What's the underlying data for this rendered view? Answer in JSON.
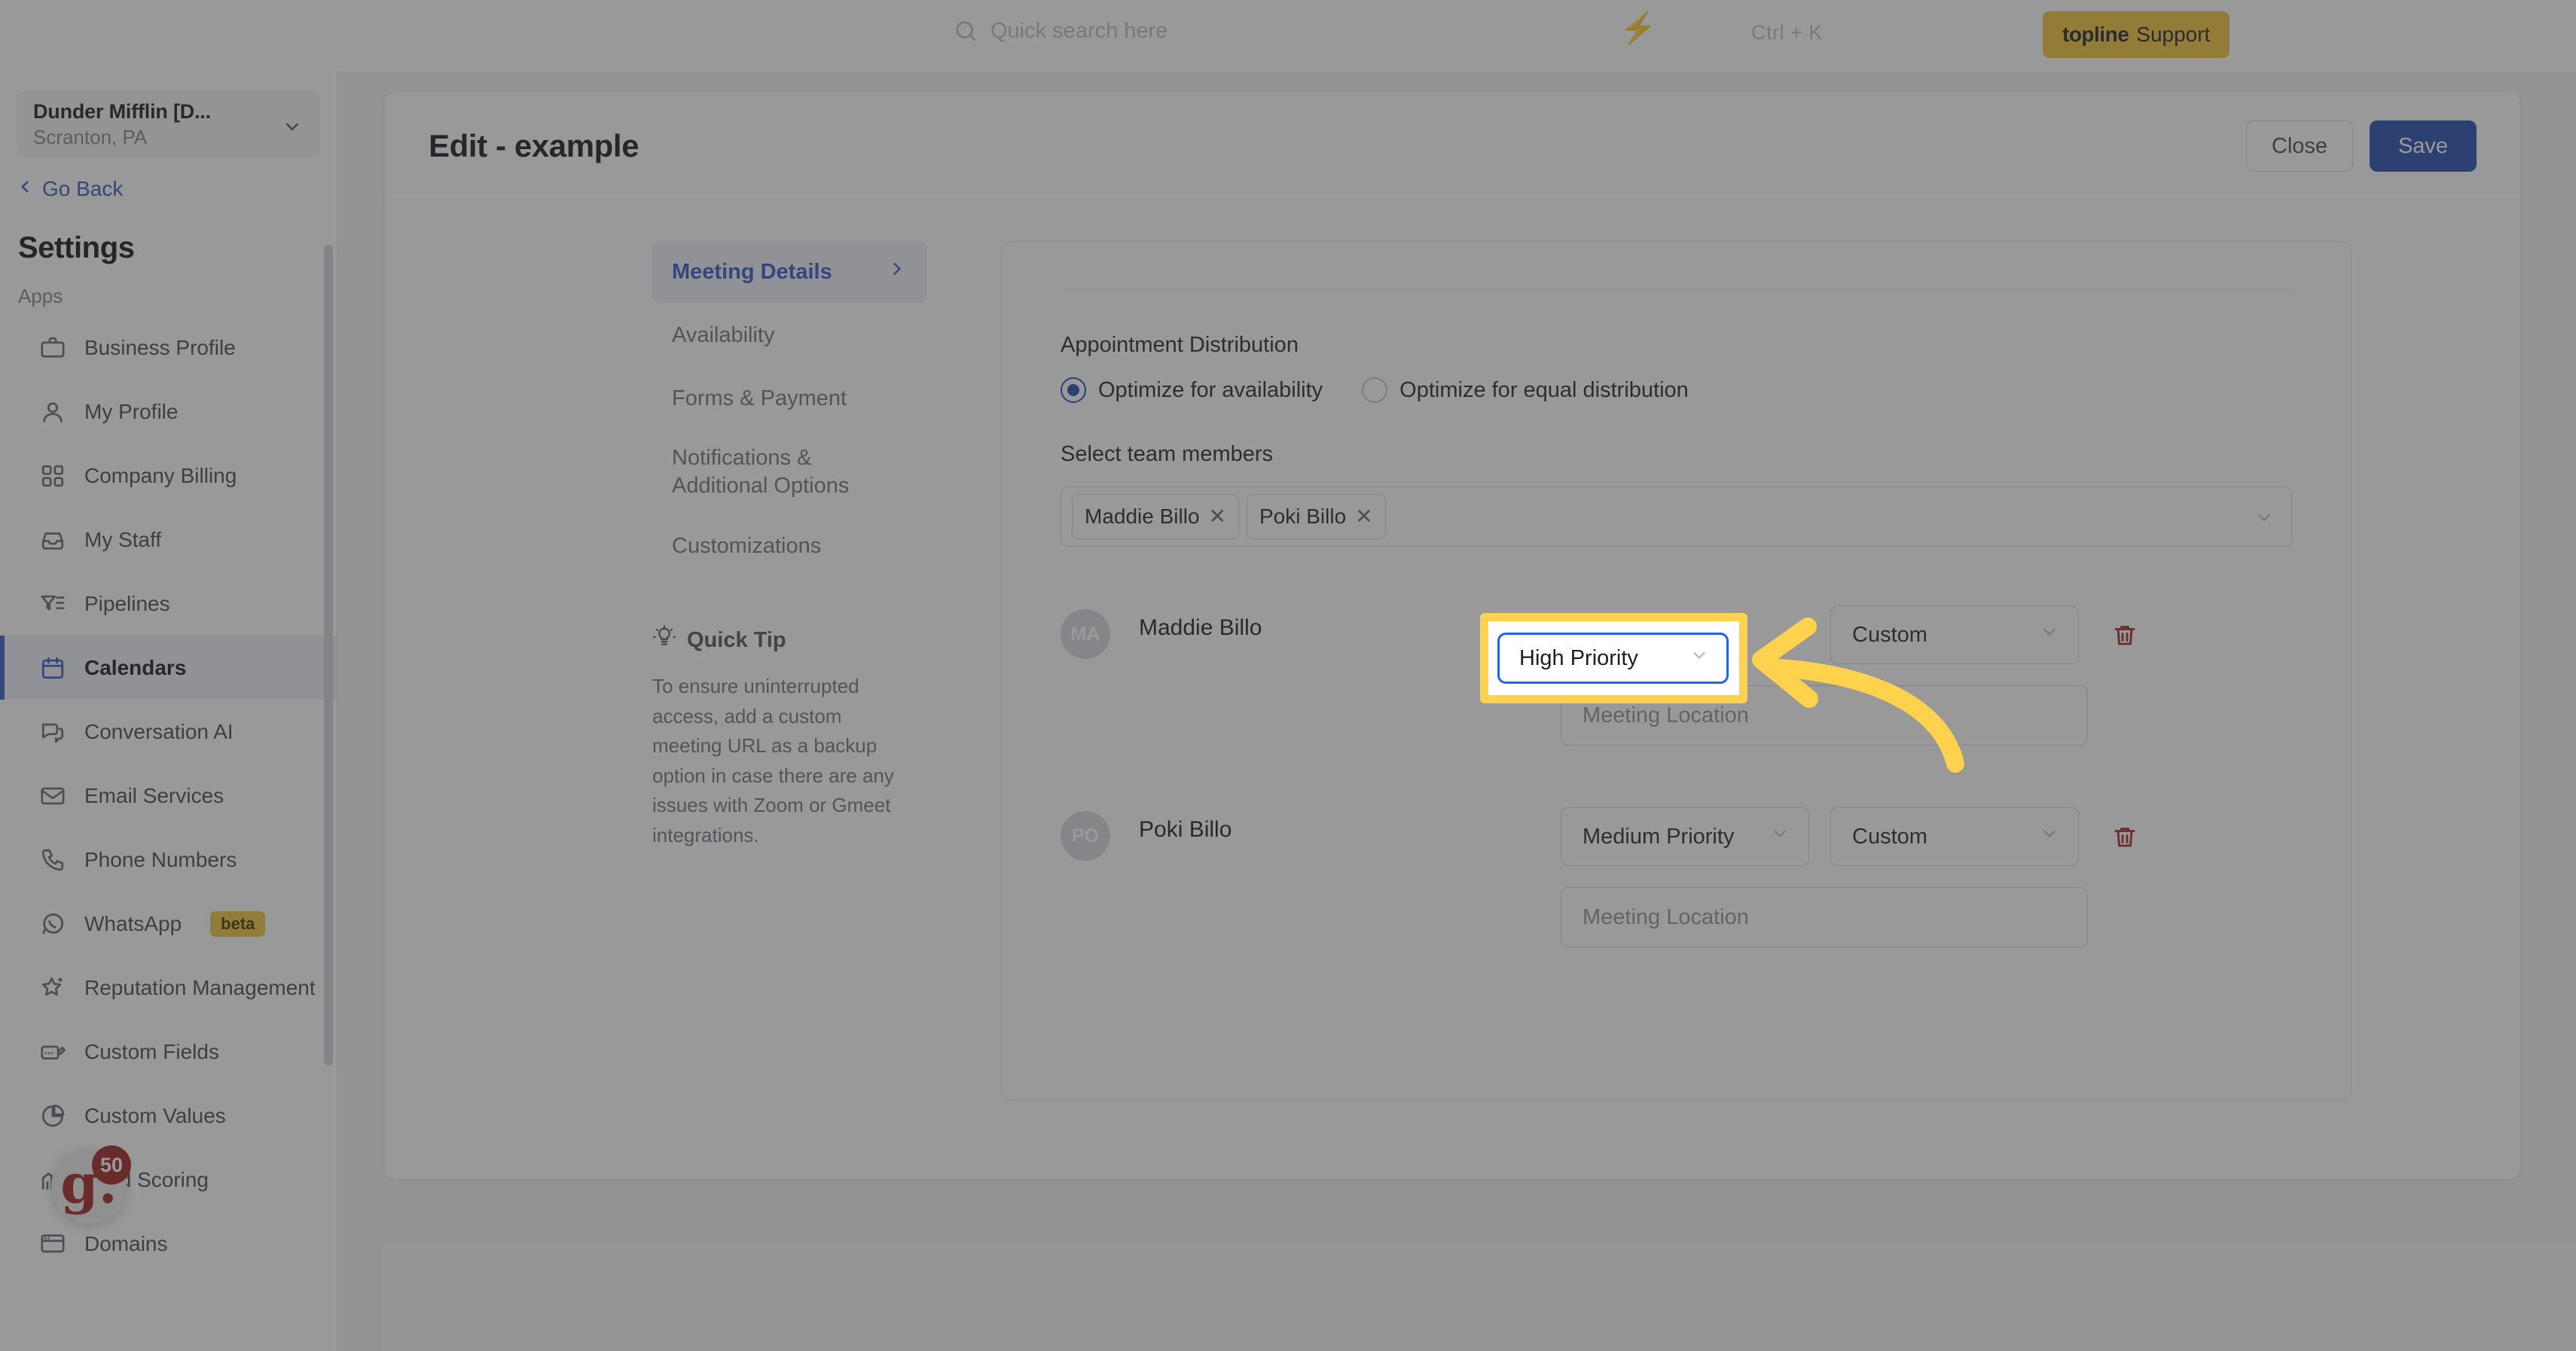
{
  "topbar": {
    "search_placeholder": "Quick search here",
    "shortcut": "Ctrl + K",
    "bolt_icon": "lightning-bolt-icon",
    "search_icon": "search-icon",
    "support_brand": "topline",
    "support_word": "Support"
  },
  "sidebar": {
    "org": {
      "name": "Dunder Mifflin [D...",
      "location": "Scranton, PA",
      "chevron_icon": "chevron-down-icon"
    },
    "go_back": "Go Back",
    "back_icon": "chevron-left-icon",
    "title": "Settings",
    "group_label": "Apps",
    "items": [
      {
        "label": "Business Profile",
        "icon": "briefcase-icon",
        "active": false,
        "badge": ""
      },
      {
        "label": "My Profile",
        "icon": "user-icon",
        "active": false,
        "badge": ""
      },
      {
        "label": "Company Billing",
        "icon": "calculator-icon",
        "active": false,
        "badge": ""
      },
      {
        "label": "My Staff",
        "icon": "inbox-icon",
        "active": false,
        "badge": ""
      },
      {
        "label": "Pipelines",
        "icon": "funnel-icon",
        "active": false,
        "badge": ""
      },
      {
        "label": "Calendars",
        "icon": "calendar-icon",
        "active": true,
        "badge": ""
      },
      {
        "label": "Conversation AI",
        "icon": "chat-icon",
        "active": false,
        "badge": ""
      },
      {
        "label": "Email Services",
        "icon": "envelope-icon",
        "active": false,
        "badge": ""
      },
      {
        "label": "Phone Numbers",
        "icon": "phone-icon",
        "active": false,
        "badge": ""
      },
      {
        "label": "WhatsApp",
        "icon": "whatsapp-icon",
        "active": false,
        "badge": "beta"
      },
      {
        "label": "Reputation Management",
        "icon": "star-icon",
        "active": false,
        "badge": ""
      },
      {
        "label": "Custom Fields",
        "icon": "edit-field-icon",
        "active": false,
        "badge": ""
      },
      {
        "label": "Custom Values",
        "icon": "pie-chart-icon",
        "active": false,
        "badge": ""
      },
      {
        "label": "Lead Scoring",
        "icon": "chart-line-icon",
        "active": false,
        "badge": ""
      },
      {
        "label": "Domains",
        "icon": "browser-icon",
        "active": false,
        "badge": ""
      }
    ]
  },
  "help_widget": {
    "logo": "g.",
    "count": "50"
  },
  "editor": {
    "title": "Edit - example",
    "close_label": "Close",
    "save_label": "Save",
    "tabs": [
      {
        "label": "Meeting Details",
        "active": true,
        "chevron_icon": "chevron-right-icon"
      },
      {
        "label": "Availability",
        "active": false,
        "chevron_icon": ""
      },
      {
        "label": "Forms & Payment",
        "active": false,
        "chevron_icon": ""
      },
      {
        "label": "Notifications & Additional Options",
        "active": false,
        "chevron_icon": ""
      },
      {
        "label": "Customizations",
        "active": false,
        "chevron_icon": ""
      }
    ],
    "quick_tip": {
      "icon": "lightbulb-icon",
      "heading": "Quick Tip",
      "body": "To ensure uninterrupted access, add a custom meeting URL as a backup option in case there are any issues with Zoom or Gmeet integrations."
    }
  },
  "form": {
    "distribution_label": "Appointment Distribution",
    "distribution_options": [
      {
        "label": "Optimize for availability",
        "checked": true
      },
      {
        "label": "Optimize for equal distribution",
        "checked": false
      }
    ],
    "team_label": "Select team members",
    "team_chips": [
      {
        "label": "Maddie Billo",
        "remove_icon": "close-icon"
      },
      {
        "label": "Poki Billo",
        "remove_icon": "close-icon"
      }
    ],
    "multiselect_chevron_icon": "chevron-down-icon",
    "members": [
      {
        "initials": "MA",
        "name": "Maddie Billo",
        "priority": "High Priority",
        "meeting_type": "Custom",
        "location_placeholder": "Meeting Location",
        "delete_icon": "trash-icon",
        "highlighted": true
      },
      {
        "initials": "PO",
        "name": "Poki Billo",
        "priority": "Medium Priority",
        "meeting_type": "Custom",
        "location_placeholder": "Meeting Location",
        "delete_icon": "trash-icon",
        "highlighted": false
      }
    ]
  },
  "annotation": {
    "highlight_color": "#ffd24d",
    "arrow_color": "#ffd24d",
    "focus_border_color": "#2563eb",
    "arrow_icon": "curved-arrow-left-icon",
    "highlighted_value": "High Priority",
    "highlighted_chevron_icon": "chevron-down-icon"
  }
}
